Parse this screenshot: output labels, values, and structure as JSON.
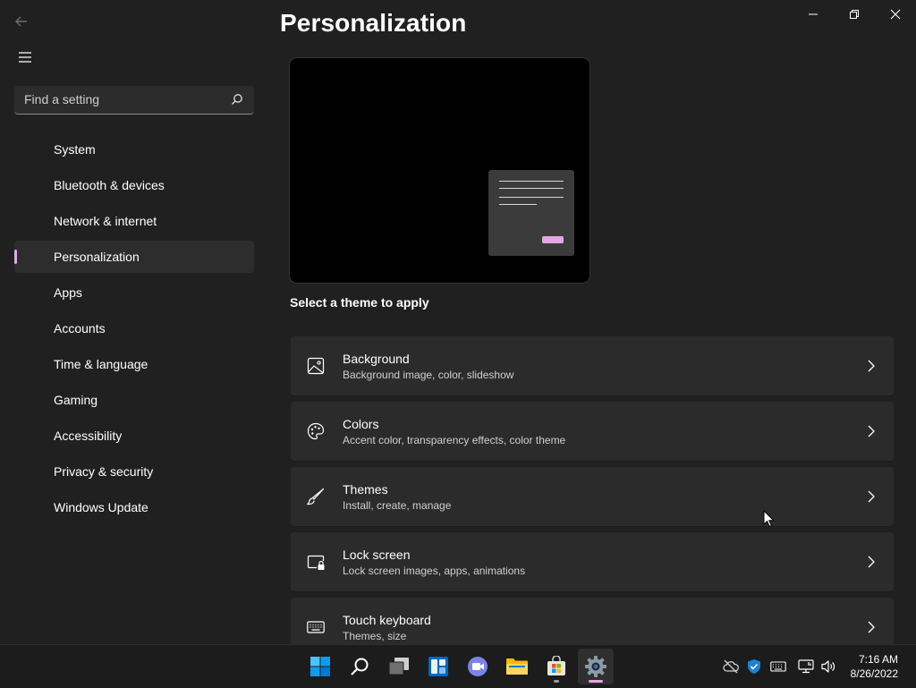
{
  "window": {
    "title": "Personalization",
    "controls": [
      "minimize",
      "restore",
      "close"
    ]
  },
  "sidebar": {
    "search": {
      "placeholder": "Find a setting",
      "value": ""
    },
    "items": [
      {
        "label": "System"
      },
      {
        "label": "Bluetooth & devices"
      },
      {
        "label": "Network & internet"
      },
      {
        "label": "Personalization",
        "active": true
      },
      {
        "label": "Apps"
      },
      {
        "label": "Accounts"
      },
      {
        "label": "Time & language"
      },
      {
        "label": "Gaming"
      },
      {
        "label": "Accessibility"
      },
      {
        "label": "Privacy & security"
      },
      {
        "label": "Windows Update"
      }
    ]
  },
  "main": {
    "section_label": "Select a theme to apply",
    "cards": [
      {
        "title": "Background",
        "subtitle": "Background image, color, slideshow",
        "icon": "image-icon"
      },
      {
        "title": "Colors",
        "subtitle": "Accent color, transparency effects, color theme",
        "icon": "palette-icon"
      },
      {
        "title": "Themes",
        "subtitle": "Install, create, manage",
        "icon": "brush-icon"
      },
      {
        "title": "Lock screen",
        "subtitle": "Lock screen images, apps, animations",
        "icon": "lock-screen-icon"
      },
      {
        "title": "Touch keyboard",
        "subtitle": "Themes, size",
        "icon": "keyboard-icon"
      }
    ]
  },
  "taskbar": {
    "apps": [
      "start-icon",
      "search-icon",
      "task-view-icon",
      "widgets-icon",
      "teams-chat-icon",
      "file-explorer-icon",
      "store-icon",
      "settings-icon"
    ],
    "tray": [
      "onedrive-offline-icon",
      "security-icon",
      "keyboard-layout-icon",
      "network-icon",
      "volume-icon"
    ],
    "clock": {
      "time": "7:16 AM",
      "date": "8/26/2022"
    }
  },
  "colors": {
    "background": "#202020",
    "card": "#2b2b2b",
    "accent": "#e4a7e6",
    "taskbar": "#1c1c1c"
  }
}
